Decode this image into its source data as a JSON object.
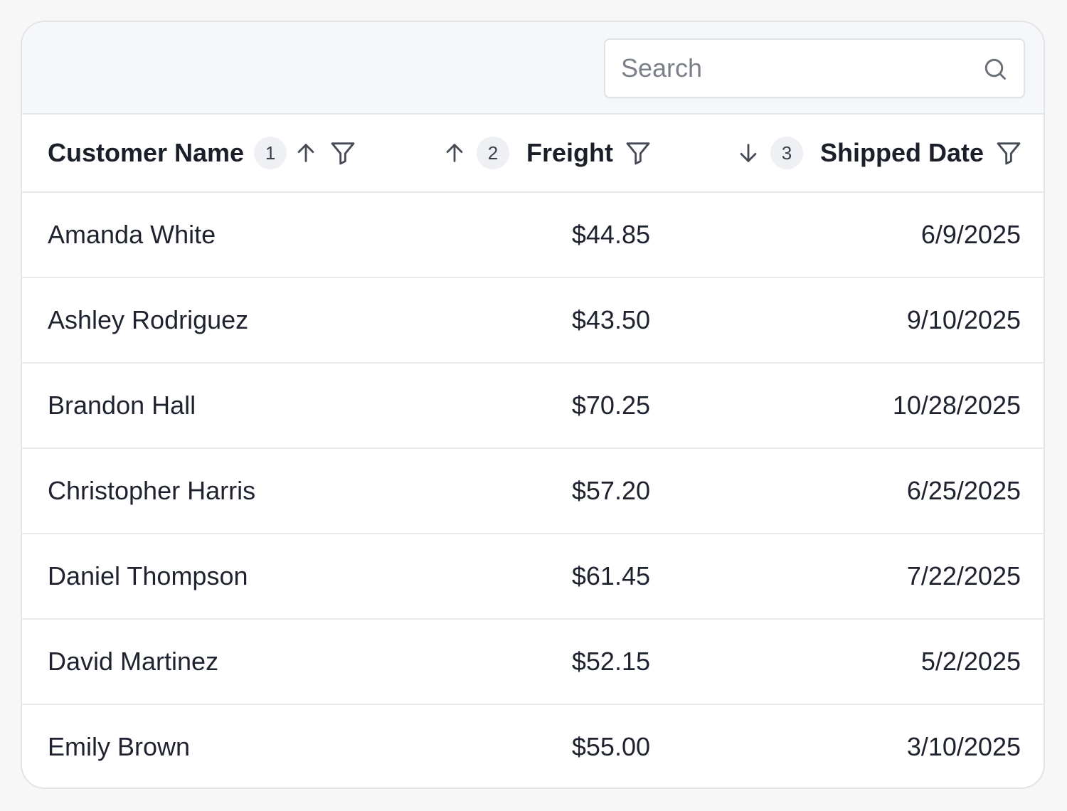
{
  "search": {
    "placeholder": "Search",
    "value": ""
  },
  "table": {
    "columns": [
      {
        "label": "Customer Name",
        "sort_order": "1",
        "sort_direction": "ascending"
      },
      {
        "label": "Freight",
        "sort_order": "2",
        "sort_direction": "ascending"
      },
      {
        "label": "Shipped Date",
        "sort_order": "3",
        "sort_direction": "descending"
      }
    ],
    "rows": [
      {
        "customer": "Amanda White",
        "freight": "$44.85",
        "shipped": "6/9/2025"
      },
      {
        "customer": "Ashley Rodriguez",
        "freight": "$43.50",
        "shipped": "9/10/2025"
      },
      {
        "customer": "Brandon Hall",
        "freight": "$70.25",
        "shipped": "10/28/2025"
      },
      {
        "customer": "Christopher Harris",
        "freight": "$57.20",
        "shipped": "6/25/2025"
      },
      {
        "customer": "Daniel Thompson",
        "freight": "$61.45",
        "shipped": "7/22/2025"
      },
      {
        "customer": "David Martinez",
        "freight": "$52.15",
        "shipped": "5/2/2025"
      },
      {
        "customer": "Emily Brown",
        "freight": "$55.00",
        "shipped": "3/10/2025"
      }
    ]
  },
  "icons": {
    "search": "search-icon",
    "sort_up": "arrow-up-icon",
    "sort_down": "arrow-down-icon",
    "filter": "filter-icon"
  },
  "colors": {
    "toolbar_bg": "#f5f7fa",
    "border": "#e3e6ea",
    "text": "#1f2330",
    "badge_bg": "#eef0f3"
  }
}
